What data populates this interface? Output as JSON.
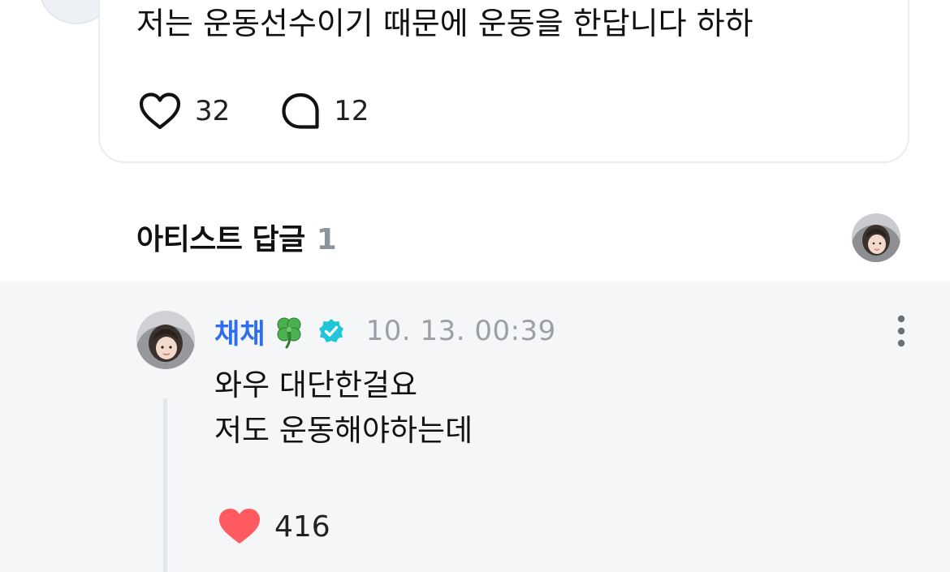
{
  "post": {
    "text": "저는 운동선수이기 때문에 운동을 한답니다 하하",
    "like_count": "32",
    "comment_count": "12"
  },
  "artist_replies": {
    "title": "아티스트 답글",
    "count": "1"
  },
  "reply": {
    "author": "채채",
    "author_emoji_icon": "four-leaf-clover-icon",
    "verified_icon": "verified-badge-icon",
    "timestamp": "10. 13. 00:39",
    "lines": [
      "와우 대단한걸요",
      "저도 운동해야하는데"
    ],
    "like_count": "416",
    "liked": true
  },
  "colors": {
    "author_name": "#2f6df0",
    "verified_badge": "#1fc6d9",
    "liked_heart": "#ff5a5f",
    "timestamp": "#9aa0a6",
    "reply_background": "#f5f6f8"
  }
}
